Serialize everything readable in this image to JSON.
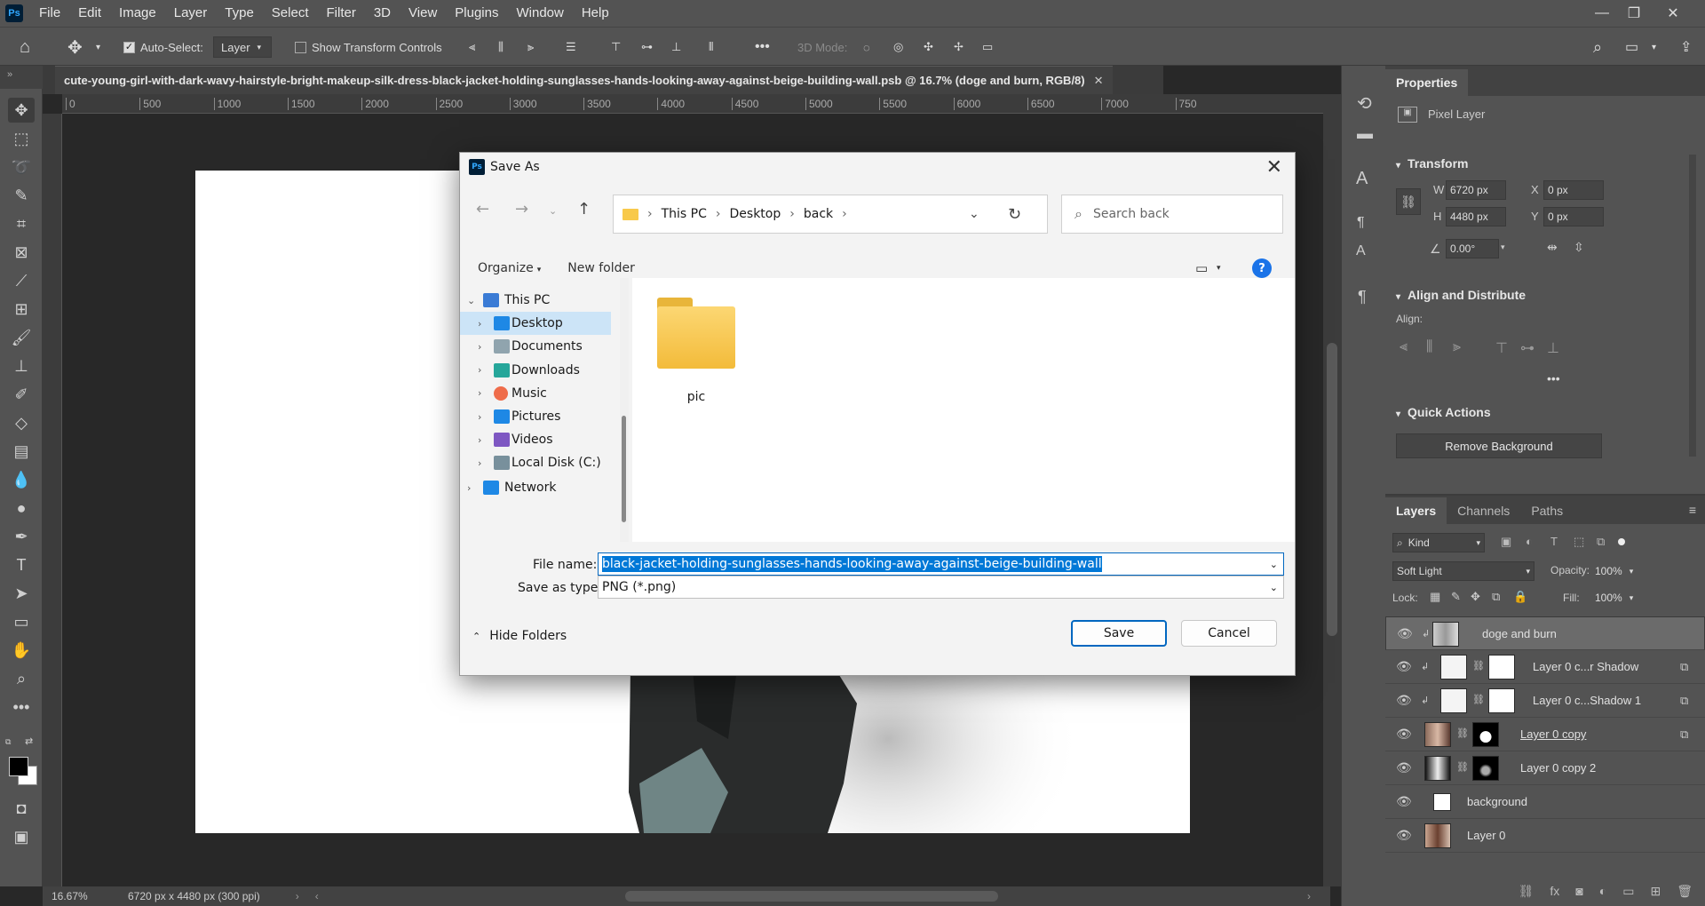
{
  "menubar": {
    "logo": "Ps",
    "items": [
      "File",
      "Edit",
      "Image",
      "Layer",
      "Type",
      "Select",
      "Filter",
      "3D",
      "View",
      "Plugins",
      "Window",
      "Help"
    ]
  },
  "options": {
    "auto_select_label": "Auto-Select:",
    "auto_select_value": "Layer",
    "show_transform_label": "Show Transform Controls",
    "mode_3d_label": "3D Mode:",
    "more": "•••"
  },
  "document": {
    "tab_title": "cute-young-girl-with-dark-wavy-hairstyle-bright-makeup-silk-dress-black-jacket-holding-sunglasses-hands-looking-away-against-beige-building-wall.psb @ 16.7% (doge and burn, RGB/8)",
    "ruler_ticks": [
      "0",
      "500",
      "1000",
      "1500",
      "2000",
      "2500",
      "3000",
      "3500",
      "4000",
      "4500",
      "5000",
      "5500",
      "6000",
      "6500",
      "7000",
      "750"
    ]
  },
  "status": {
    "zoom": "16.67%",
    "doc_info": "6720 px x 4480 px (300 ppi)"
  },
  "properties": {
    "tab": "Properties",
    "layer_type": "Pixel Layer",
    "transform_label": "Transform",
    "w_label": "W",
    "w_value": "6720 px",
    "h_label": "H",
    "h_value": "4480 px",
    "x_label": "X",
    "x_value": "0 px",
    "y_label": "Y",
    "y_value": "0 px",
    "angle": "0.00°",
    "align_label": "Align and Distribute",
    "align_sub": "Align:",
    "quick_actions_label": "Quick Actions",
    "remove_bg": "Remove Background"
  },
  "layers": {
    "tabs": [
      "Layers",
      "Channels",
      "Paths"
    ],
    "kind": "Kind",
    "blend_mode": "Soft Light",
    "opacity_label": "Opacity:",
    "opacity": "100%",
    "lock_label": "Lock:",
    "fill_label": "Fill:",
    "fill": "100%",
    "items": [
      {
        "name": "doge and burn"
      },
      {
        "name": "Layer 0 c...r Shadow"
      },
      {
        "name": "Layer 0 c...Shadow 1"
      },
      {
        "name": "Layer 0 copy"
      },
      {
        "name": "Layer 0 copy 2"
      },
      {
        "name": "background"
      },
      {
        "name": "Layer 0"
      }
    ]
  },
  "dialog": {
    "title": "Save As",
    "breadcrumb": [
      "This PC",
      "Desktop",
      "back"
    ],
    "search_placeholder": "Search back",
    "organize": "Organize",
    "new_folder": "New folder",
    "nav": [
      {
        "label": "This PC",
        "icon": "pc-icon"
      },
      {
        "label": "Desktop",
        "icon": "desktop-icon"
      },
      {
        "label": "Documents",
        "icon": "documents-icon"
      },
      {
        "label": "Downloads",
        "icon": "downloads-icon"
      },
      {
        "label": "Music",
        "icon": "music-icon"
      },
      {
        "label": "Pictures",
        "icon": "pictures-icon"
      },
      {
        "label": "Videos",
        "icon": "videos-icon"
      },
      {
        "label": "Local Disk (C:)",
        "icon": "disk-icon"
      },
      {
        "label": "Network",
        "icon": "network-icon"
      }
    ],
    "folder_name": "pic",
    "file_name_label": "File name:",
    "file_name_value": "black-jacket-holding-sunglasses-hands-looking-away-against-beige-building-wall",
    "save_type_label": "Save as type:",
    "save_type_value": "PNG (*.png)",
    "hide_folders": "Hide Folders",
    "save": "Save",
    "cancel": "Cancel"
  },
  "colors": {
    "accent": "#0067c0",
    "folder": "#f8c94a",
    "ps_blue": "#31a8ff"
  }
}
